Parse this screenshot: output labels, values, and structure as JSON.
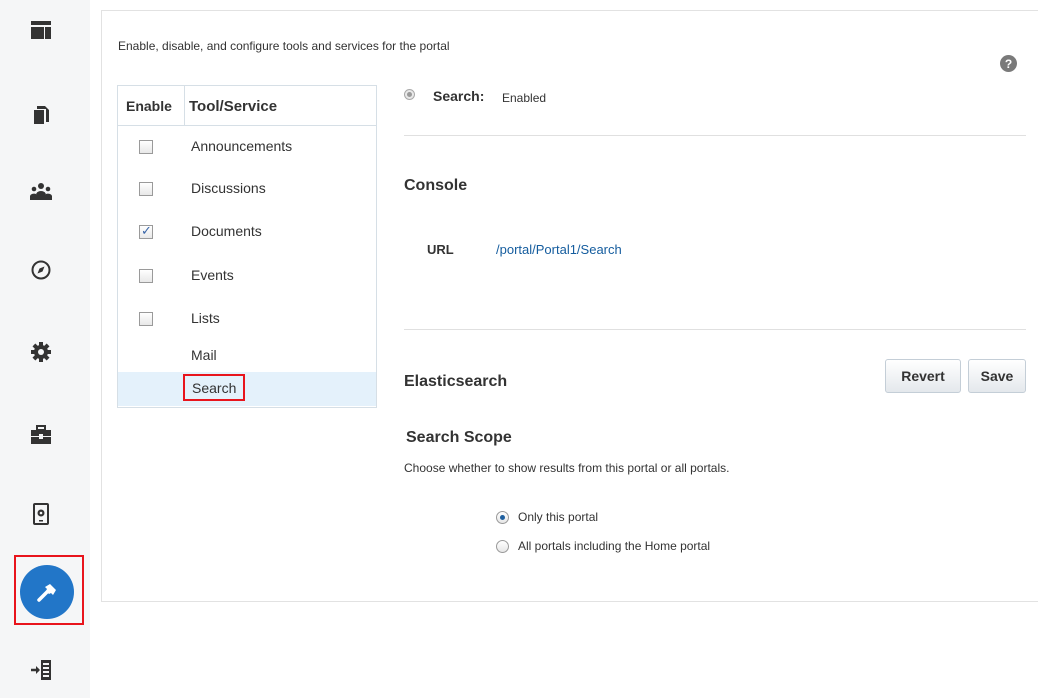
{
  "rail": {
    "items": [
      {
        "icon": "layout-icon"
      },
      {
        "icon": "pages-icon"
      },
      {
        "icon": "people-icon"
      },
      {
        "icon": "compass-icon"
      },
      {
        "icon": "gear-icon"
      },
      {
        "icon": "toolbox-icon"
      },
      {
        "icon": "device-settings-icon"
      },
      {
        "icon": "hammer-icon",
        "active": true
      },
      {
        "icon": "exit-icon"
      }
    ],
    "accent": "#2276c8",
    "highlight": "#e8141c"
  },
  "panel": {
    "description": "Enable, disable, and configure tools and services for the portal",
    "help_glyph": "?"
  },
  "tools": {
    "headers": {
      "enable": "Enable",
      "tool": "Tool/Service"
    },
    "rows": [
      {
        "label": "Announcements",
        "checkbox": true,
        "checked": false
      },
      {
        "label": "Discussions",
        "checkbox": true,
        "checked": false
      },
      {
        "label": "Documents",
        "checkbox": true,
        "checked": true
      },
      {
        "label": "Events",
        "checkbox": true,
        "checked": false
      },
      {
        "label": "Lists",
        "checkbox": true,
        "checked": false
      },
      {
        "label": "Mail",
        "checkbox": false,
        "checked": false
      },
      {
        "label": "Search",
        "checkbox": false,
        "checked": false,
        "selected": true
      }
    ]
  },
  "detail": {
    "status_name": "Search:",
    "status_value": "Enabled",
    "console": {
      "title": "Console",
      "url_label": "URL",
      "url_value": "/portal/Portal1/Search"
    },
    "elasticsearch": {
      "title": "Elasticsearch",
      "revert_label": "Revert",
      "save_label": "Save"
    },
    "scope": {
      "title": "Search Scope",
      "description": "Choose whether to show results from this portal or all portals.",
      "options": [
        {
          "label": "Only this portal",
          "selected": true
        },
        {
          "label": "All portals including the Home portal",
          "selected": false
        }
      ]
    }
  }
}
